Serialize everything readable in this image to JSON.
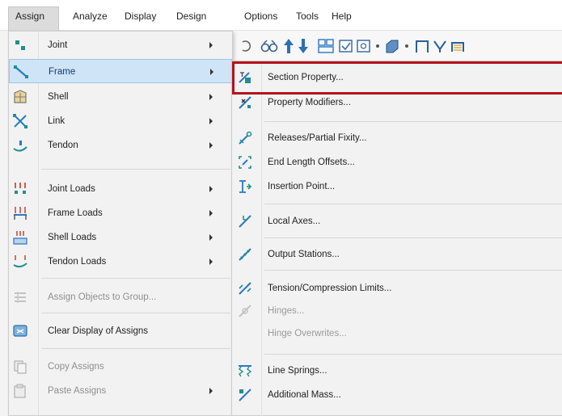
{
  "menubar": {
    "items": [
      "Assign",
      "Analyze",
      "Display",
      "Design",
      "Options",
      "Tools",
      "Help"
    ]
  },
  "assign_menu": {
    "items": [
      {
        "label": "Joint",
        "icon": "joint-icon",
        "submenu": true,
        "enabled": true
      },
      {
        "label": "Frame",
        "icon": "frame-icon",
        "submenu": true,
        "enabled": true,
        "highlighted": true
      },
      {
        "label": "Shell",
        "icon": "shell-icon",
        "submenu": true,
        "enabled": true
      },
      {
        "label": "Link",
        "icon": "link-icon",
        "submenu": true,
        "enabled": true
      },
      {
        "label": "Tendon",
        "icon": "tendon-icon",
        "submenu": true,
        "enabled": true
      },
      {
        "label": "Joint Loads",
        "icon": "joint-loads-icon",
        "submenu": true,
        "enabled": true
      },
      {
        "label": "Frame Loads",
        "icon": "frame-loads-icon",
        "submenu": true,
        "enabled": true
      },
      {
        "label": "Shell Loads",
        "icon": "shell-loads-icon",
        "submenu": true,
        "enabled": true
      },
      {
        "label": "Tendon Loads",
        "icon": "tendon-loads-icon",
        "submenu": true,
        "enabled": true
      },
      {
        "label": "Assign Objects to Group...",
        "icon": "group-icon",
        "submenu": false,
        "enabled": false
      },
      {
        "label": "Clear Display of Assigns",
        "icon": "clear-display-icon",
        "submenu": false,
        "enabled": true
      },
      {
        "label": "Copy Assigns",
        "icon": "copy-assigns-icon",
        "submenu": false,
        "enabled": false
      },
      {
        "label": "Paste Assigns",
        "icon": "paste-assigns-icon",
        "submenu": true,
        "enabled": false
      }
    ]
  },
  "frame_menu": {
    "items": [
      {
        "label": "Section Property...",
        "icon": "section-property-icon",
        "enabled": true,
        "outlined": true
      },
      {
        "label": "Property Modifiers...",
        "icon": "property-modifiers-icon",
        "enabled": true
      },
      {
        "label": "Releases/Partial Fixity...",
        "icon": "releases-icon",
        "enabled": true
      },
      {
        "label": "End Length Offsets...",
        "icon": "end-length-offsets-icon",
        "enabled": true
      },
      {
        "label": "Insertion Point...",
        "icon": "insertion-point-icon",
        "enabled": true
      },
      {
        "label": "Local Axes...",
        "icon": "local-axes-icon",
        "enabled": true
      },
      {
        "label": "Output Stations...",
        "icon": "output-stations-icon",
        "enabled": true
      },
      {
        "label": "Tension/Compression Limits...",
        "icon": "tension-compression-icon",
        "enabled": true
      },
      {
        "label": "Hinges...",
        "icon": "hinges-icon",
        "enabled": false
      },
      {
        "label": "Hinge Overwrites...",
        "icon": "",
        "enabled": false
      },
      {
        "label": "Line Springs...",
        "icon": "line-springs-icon",
        "enabled": true
      },
      {
        "label": "Additional Mass...",
        "icon": "additional-mass-icon",
        "enabled": true
      }
    ]
  },
  "colors": {
    "menu_bg": "#f2f2f2",
    "highlight_bg": "#cfe4f7",
    "outline_red": "#b5121b",
    "icon_blue": "#2b79c2",
    "icon_teal": "#1f8f8f"
  }
}
